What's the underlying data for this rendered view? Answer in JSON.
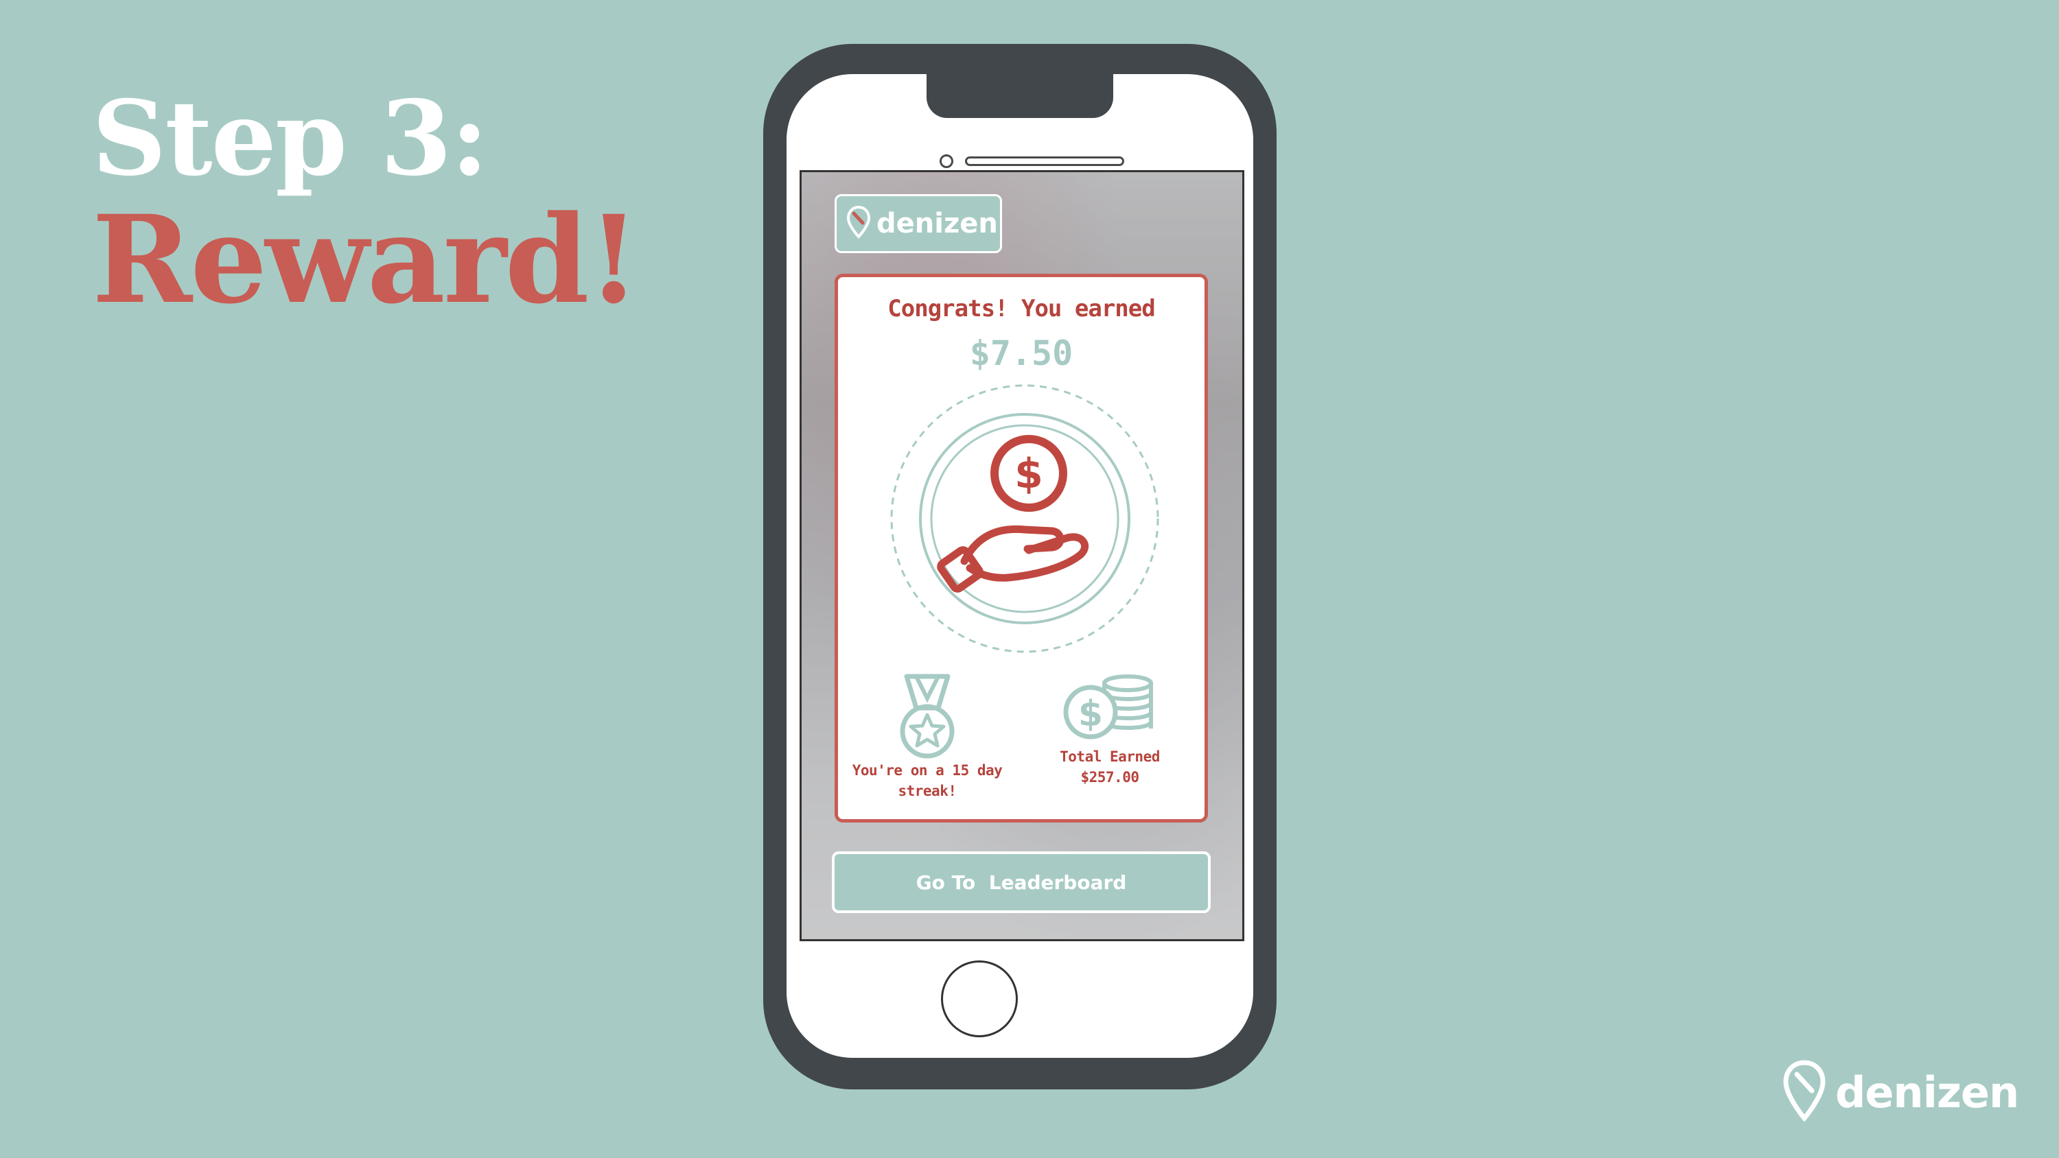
{
  "slide": {
    "step_label": "Step 3:",
    "step_name": "Reward!"
  },
  "app": {
    "brand": "denizen",
    "reward_card": {
      "heading": "Congrats! You earned",
      "amount": "$7.50",
      "streak_text": "You're on a 15 day streak!",
      "total_label": "Total Earned",
      "total_value": "$257.00"
    },
    "leaderboard_button": "Go To  Leaderboard"
  },
  "footer": {
    "brand": "denizen"
  },
  "colors": {
    "background": "#a7cbc4",
    "accent_red": "#c85d55",
    "phone_body": "#41474b"
  },
  "icons": [
    "location-pin-icon",
    "hand-coin-icon",
    "medal-star-icon",
    "coin-stack-icon"
  ]
}
